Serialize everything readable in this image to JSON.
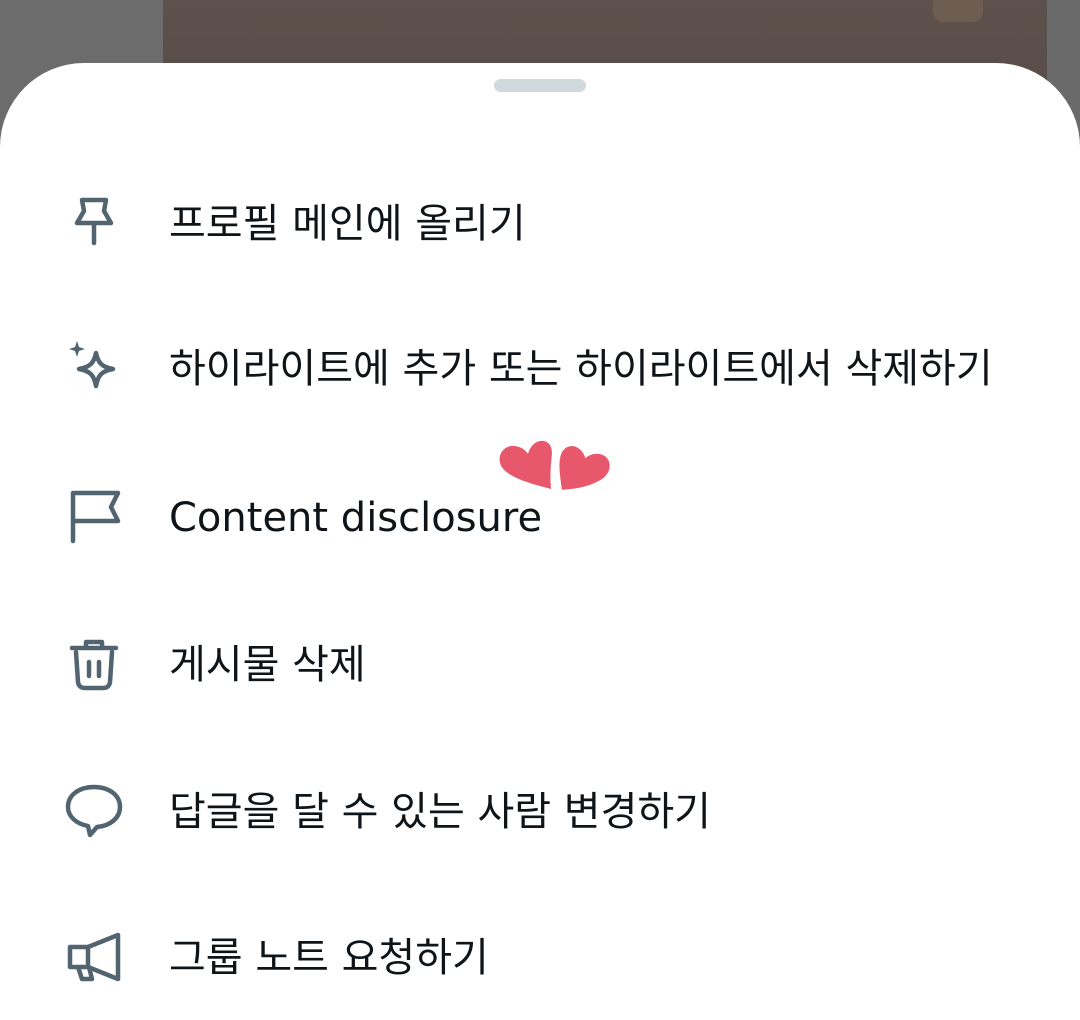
{
  "sheet": {
    "handle_icon": "drag-handle"
  },
  "menu": {
    "items": [
      {
        "label": "프로필 메인에 올리기",
        "icon": "pin-icon"
      },
      {
        "label": "하이라이트에 추가 또는 하이라이트에서 삭제하기",
        "icon": "sparkle-icon"
      },
      {
        "label": "Content disclosure",
        "icon": "flag-icon"
      },
      {
        "label": "게시물 삭제",
        "icon": "trash-icon"
      },
      {
        "label": "답글을 달 수 있는 사람 변경하기",
        "icon": "speech-bubble-icon"
      },
      {
        "label": "그룹 노트 요청하기",
        "icon": "megaphone-icon"
      }
    ]
  },
  "colors": {
    "icon": "#536471",
    "text": "#0f1419",
    "handle": "#cfd9de",
    "heart": "#e8586d"
  }
}
